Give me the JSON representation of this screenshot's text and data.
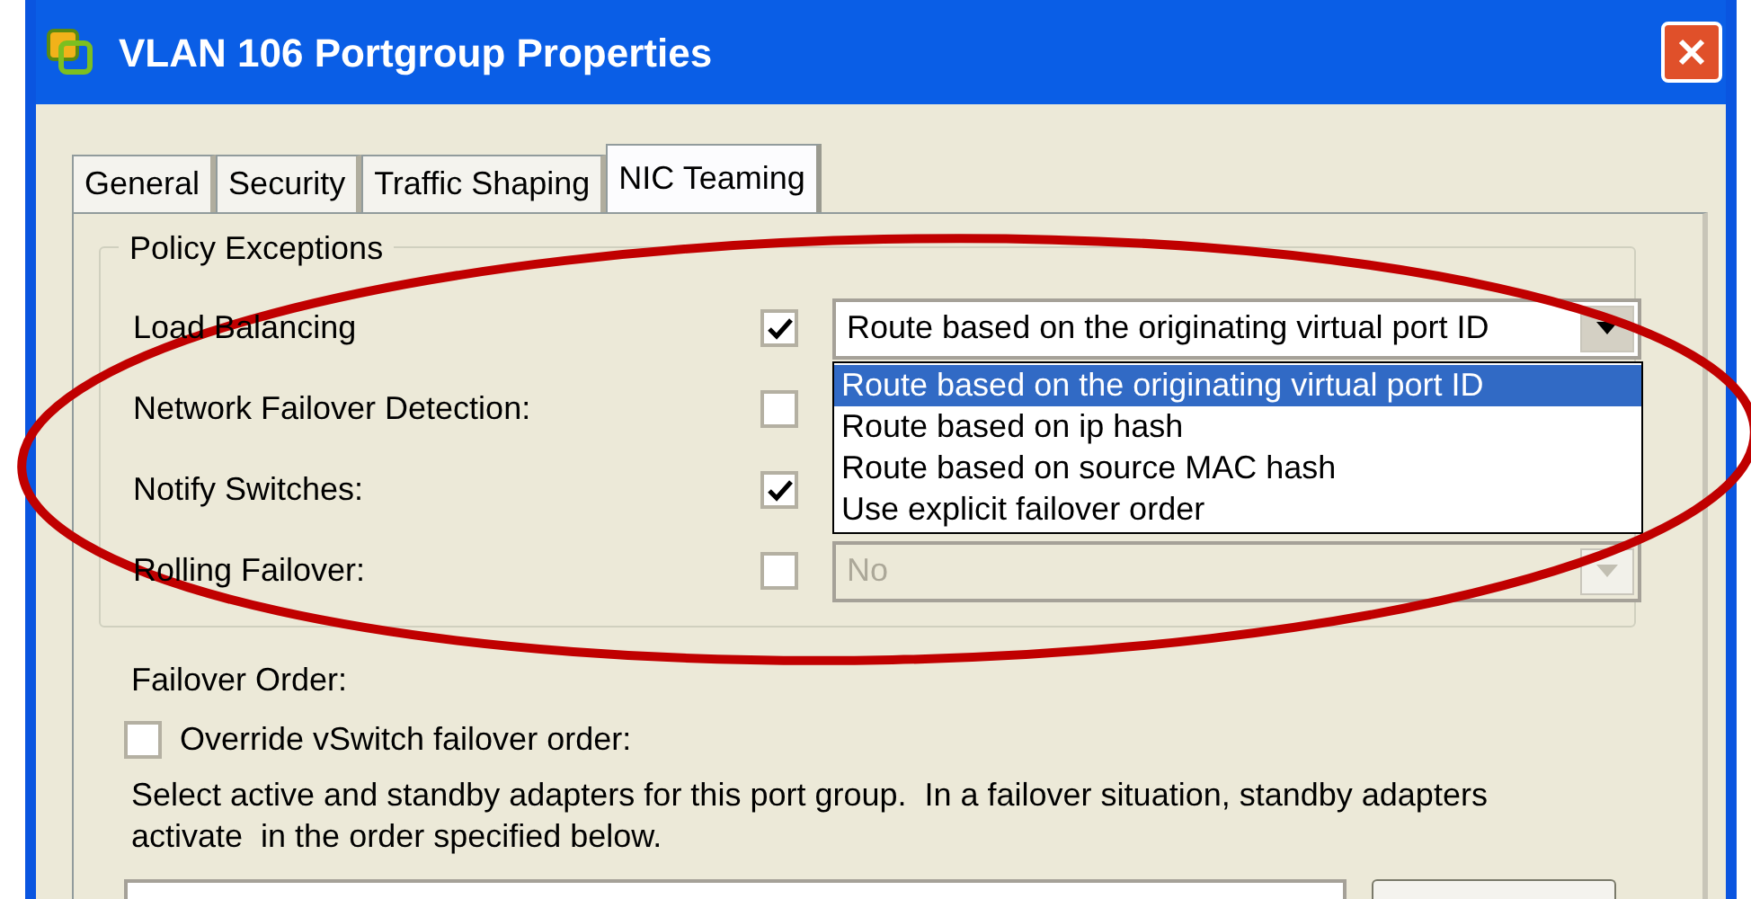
{
  "window": {
    "title": "VLAN 106 Portgroup Properties"
  },
  "tabs": [
    {
      "label": "General",
      "selected": false
    },
    {
      "label": "Security",
      "selected": false
    },
    {
      "label": "Traffic Shaping",
      "selected": false
    },
    {
      "label": "NIC Teaming",
      "selected": true
    }
  ],
  "group": {
    "title": "Policy Exceptions"
  },
  "policies": [
    {
      "label": "Load Balancing",
      "checked": true,
      "value": "Route based on the originating virtual port ID",
      "disabled": false,
      "open": true
    },
    {
      "label": "Network Failover Detection:",
      "checked": false
    },
    {
      "label": "Notify Switches:",
      "checked": true
    },
    {
      "label": "Rolling Failover:",
      "checked": false,
      "value": "No",
      "disabled": true,
      "open": false
    }
  ],
  "dropdown_list": {
    "options": [
      {
        "label": "Route based on the originating virtual port ID",
        "selected": true
      },
      {
        "label": "Route based on ip hash",
        "selected": false
      },
      {
        "label": "Route based on source MAC hash",
        "selected": false
      },
      {
        "label": "Use explicit failover order",
        "selected": false
      }
    ]
  },
  "failover_order": {
    "title": "Failover Order:",
    "override": {
      "label": "Override vSwitch failover order:",
      "checked": false
    },
    "description": "Select active and standby adapters for this port group.  In a failover situation, standby adapters activate  in the order specified below."
  }
}
